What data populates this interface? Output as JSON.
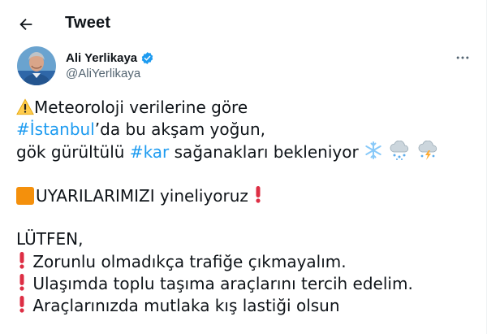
{
  "header": {
    "title": "Tweet"
  },
  "user": {
    "name": "Ali Yerlikaya",
    "handle": "@AliYerlikaya"
  },
  "tweet": {
    "line1": "Meteoroloji verilerine göre",
    "line2_tag": "#İstanbul",
    "line2_rest": "’da bu akşam yoğun,",
    "line3_pre": "gök gürültülü ",
    "line3_tag": "#kar",
    "line3_rest": " sağanakları bekleniyor",
    "line4": "UYARILARIMIZI yineliyoruz",
    "line5": "LÜTFEN,",
    "item1": "Zorunlu olmadıkça trafiğe çıkmayalım.",
    "item2": "Ulaşımda toplu taşıma araçlarını tercih edelim.",
    "item3": "Araçlarınızda mutlaka kış lastiği olsun"
  },
  "icons": [
    "back-arrow-icon",
    "verified-badge-icon",
    "more-options-icon",
    "warning-icon",
    "snowflake-icon",
    "cloud-snow-icon",
    "cloud-lightning-snow-icon",
    "orange-square-icon",
    "exclamation-icon"
  ],
  "colors": {
    "link": "#1d9bf0",
    "muted": "#536471",
    "text": "#0f1419",
    "alert": "#dd2e44",
    "orange": "#f4900c"
  }
}
